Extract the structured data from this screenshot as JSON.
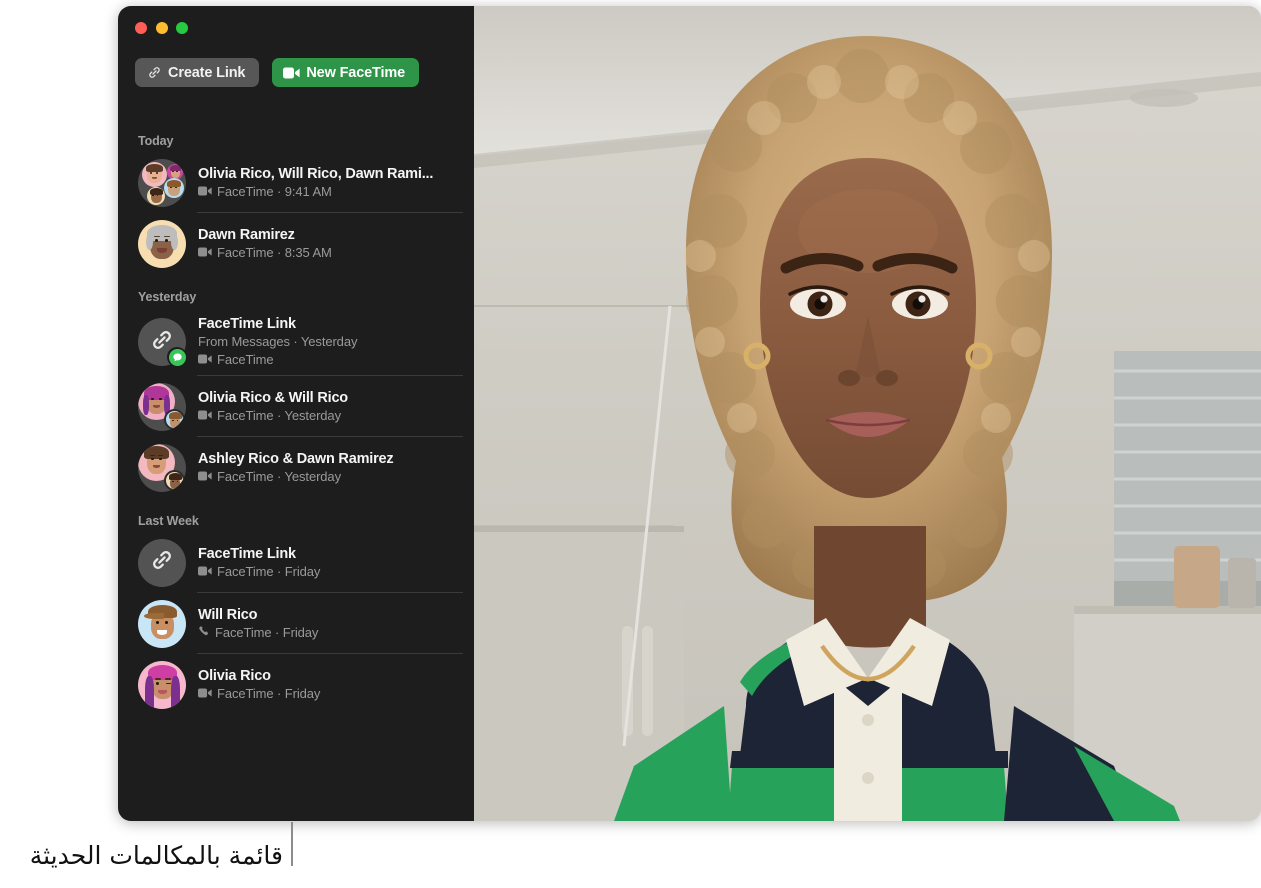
{
  "window": {
    "traffic_lights": [
      {
        "name": "close",
        "color": "#ff5f57"
      },
      {
        "name": "minimize",
        "color": "#febc2e"
      },
      {
        "name": "zoom",
        "color": "#28c840"
      }
    ]
  },
  "toolbar": {
    "create_link_label": "Create Link",
    "create_link_icon": "link-icon",
    "new_facetime_label": "New FaceTime",
    "new_facetime_icon": "video-camera-icon"
  },
  "colors": {
    "sidebar_bg": "#1d1d1d",
    "accent_green": "#2e9447",
    "secondary_button": "#575757",
    "separator": "#3a3a3a",
    "title_text": "#f5f5f5",
    "subtitle_text": "#9a9a9a",
    "section_header_text": "#a0a0a0",
    "messages_badge_green": "#37c759"
  },
  "sections": [
    {
      "header": "Today",
      "items": [
        {
          "title": "Olivia Rico, Will Rico, Dawn Rami...",
          "subtitle": "FaceTime · 9:41 AM",
          "call_type_icon": "video-camera-icon",
          "avatar": "group-avatar",
          "secondary_line": null,
          "badge": null
        },
        {
          "title": "Dawn Ramirez",
          "subtitle": "FaceTime · 8:35 AM",
          "call_type_icon": "video-camera-icon",
          "avatar": "memoji-dawn",
          "secondary_line": null,
          "badge": null
        }
      ]
    },
    {
      "header": "Yesterday",
      "items": [
        {
          "title": "FaceTime Link",
          "secondary_line": "From Messages · Yesterday",
          "subtitle": "FaceTime",
          "call_type_icon": "video-camera-icon",
          "avatar": "link-avatar",
          "badge": "messages-badge"
        },
        {
          "title": "Olivia Rico & Will Rico",
          "subtitle": "FaceTime · Yesterday",
          "call_type_icon": "video-camera-icon",
          "avatar": "pair-olivia-will",
          "secondary_line": null,
          "badge": null
        },
        {
          "title": "Ashley Rico & Dawn Ramirez",
          "subtitle": "FaceTime · Yesterday",
          "call_type_icon": "video-camera-icon",
          "avatar": "pair-ashley-dawn",
          "secondary_line": null,
          "badge": null
        }
      ]
    },
    {
      "header": "Last Week",
      "items": [
        {
          "title": "FaceTime Link",
          "subtitle": "FaceTime · Friday",
          "call_type_icon": "video-camera-icon",
          "avatar": "link-avatar",
          "secondary_line": null,
          "badge": null
        },
        {
          "title": "Will Rico",
          "subtitle": "FaceTime · Friday",
          "call_type_icon": "phone-icon",
          "avatar": "memoji-will",
          "secondary_line": null,
          "badge": null
        },
        {
          "title": "Olivia Rico",
          "subtitle": "FaceTime · Friday",
          "call_type_icon": "video-camera-icon",
          "avatar": "memoji-olivia",
          "secondary_line": null,
          "badge": null
        }
      ]
    }
  ],
  "video_pane": {
    "description": "Video call participant portrait"
  },
  "annotation": {
    "caption": "قائمة بالمكالمات الحديثة"
  }
}
